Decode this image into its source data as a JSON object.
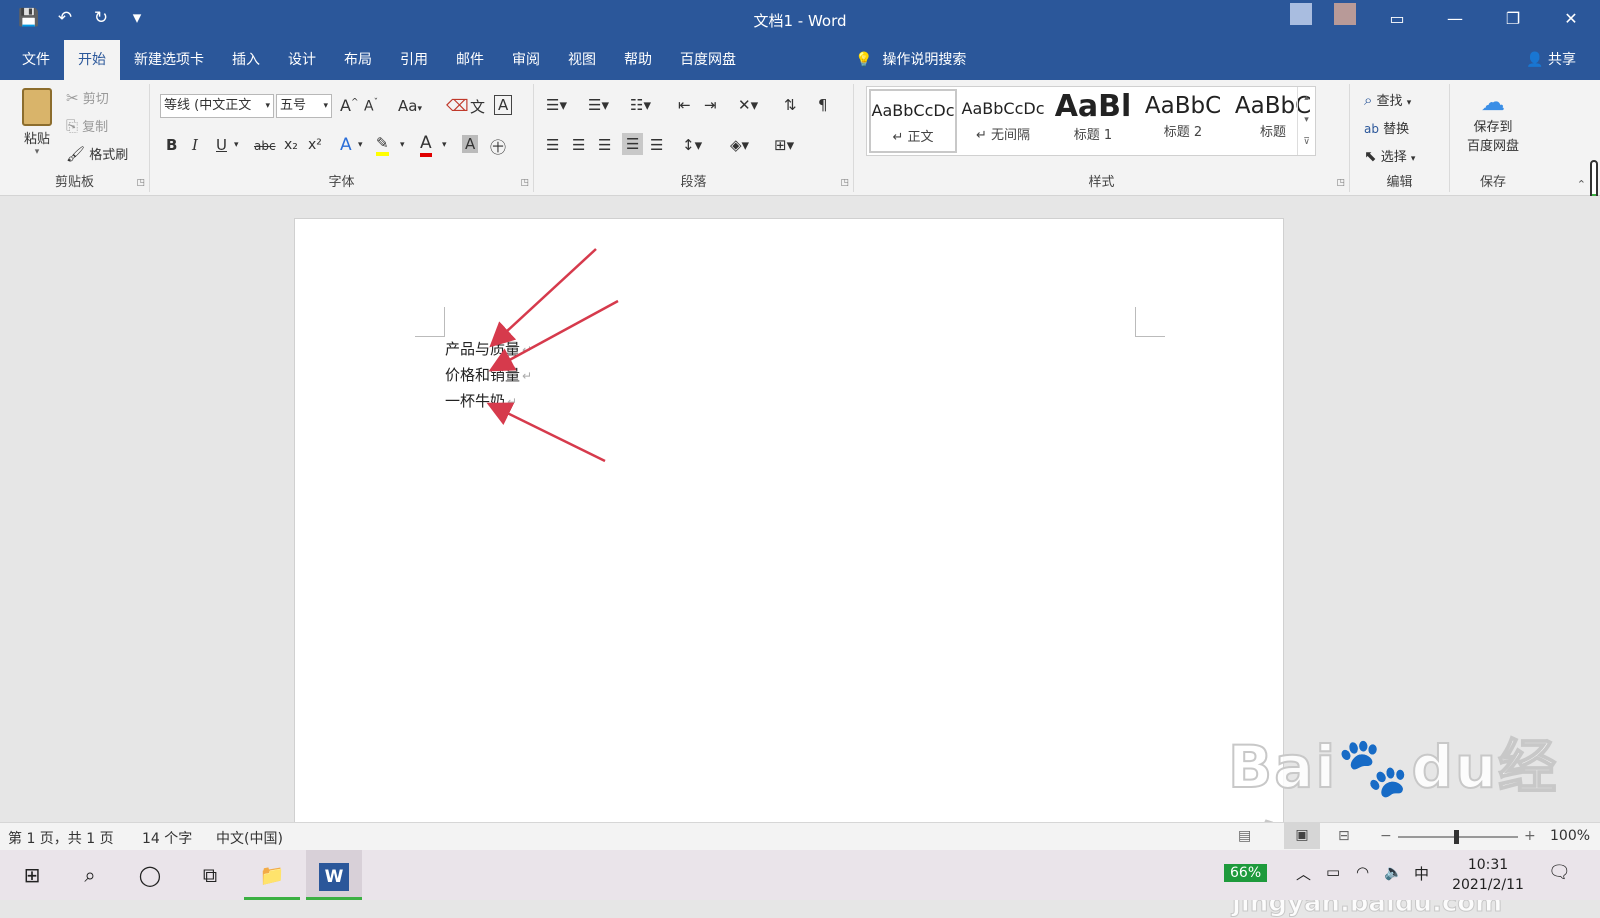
{
  "window": {
    "title": "文档1 - Word",
    "share": "共享",
    "controls": [
      "▭",
      "—",
      "❐",
      "✕"
    ]
  },
  "qat": [
    "💾",
    "↶",
    "↻",
    "▾"
  ],
  "tabs": [
    "文件",
    "开始",
    "新建选项卡",
    "插入",
    "设计",
    "布局",
    "引用",
    "邮件",
    "审阅",
    "视图",
    "帮助",
    "百度网盘"
  ],
  "tell_me": {
    "icon": "lightbulb-icon",
    "label": "操作说明搜索"
  },
  "clipboard": {
    "paste": "粘贴",
    "cut": "剪切",
    "copy": "复制",
    "format_painter": "格式刷",
    "label": "剪贴板"
  },
  "font": {
    "name": "等线 (中文正文",
    "size": "五号",
    "grow": "A",
    "shrink": "A",
    "case": "Aa",
    "bold": "B",
    "italic": "I",
    "underline": "U",
    "strike": "abc",
    "sub": "x₂",
    "sup": "x²",
    "label": "字体"
  },
  "paragraph": {
    "label": "段落"
  },
  "styles": {
    "label": "样式",
    "items": [
      {
        "sample": "AaBbCcDc",
        "name": "正文"
      },
      {
        "sample": "AaBbCcDc",
        "name": "无间隔"
      },
      {
        "sample": "AaBl",
        "name": "标题 1"
      },
      {
        "sample": "AaBbC",
        "name": "标题 2"
      },
      {
        "sample": "AaBbC",
        "name": "标题"
      }
    ]
  },
  "editing": {
    "find": "查找",
    "replace": "替换",
    "select": "选择",
    "label": "编辑"
  },
  "save": {
    "line1": "保存到",
    "line2": "百度网盘",
    "label": "保存"
  },
  "document": {
    "lines": [
      "产品与质量",
      "价格和销量",
      "一杯牛奶"
    ],
    "para_mark": "↵"
  },
  "status": {
    "page": "第 1 页，共 1 页",
    "words": "14 个字",
    "language": "中文(中国)",
    "zoom": "100%"
  },
  "taskbar": {
    "battery": "66%",
    "ime": "中",
    "time": "10:31",
    "date": "2021/2/11"
  },
  "watermark": {
    "brand": "Bai",
    "brand2": "du",
    "cn": "经验",
    "url": "jingyan.baidu.com"
  },
  "colors": {
    "accent": "#2b579a",
    "arrow": "#d63a4c",
    "font_red": "#e00000",
    "highlight": "#ffff00"
  }
}
